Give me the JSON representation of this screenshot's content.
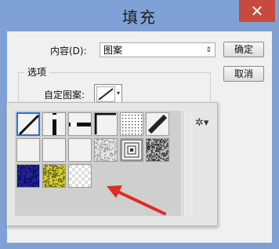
{
  "window": {
    "title": "填充",
    "close_glyph": "✕"
  },
  "content_row": {
    "label": "内容(D):",
    "selected": "图案",
    "arrow": "⇕"
  },
  "buttons": {
    "ok": "确定",
    "cancel": "取消"
  },
  "options": {
    "group_title": "选项",
    "custom_pattern_label": "自定图案:",
    "dropdown_arrow": "▾"
  },
  "pattern_picker": {
    "menu_icon": "gear-icon",
    "menu_glyph": "✲▾",
    "patterns": [
      "diagonal-line",
      "vertical-bar",
      "horizontal-dash",
      "corner-frame",
      "dots",
      "diagonal-thick",
      "blank-1",
      "blank-2",
      "blank-3",
      "noise-light",
      "concentric-squares",
      "noise-dark",
      "blue-noise",
      "yellow-noise",
      "checkerboard"
    ],
    "selected_pattern": "diagonal-line"
  },
  "annotation": {
    "arrow_color": "#e02b24"
  }
}
